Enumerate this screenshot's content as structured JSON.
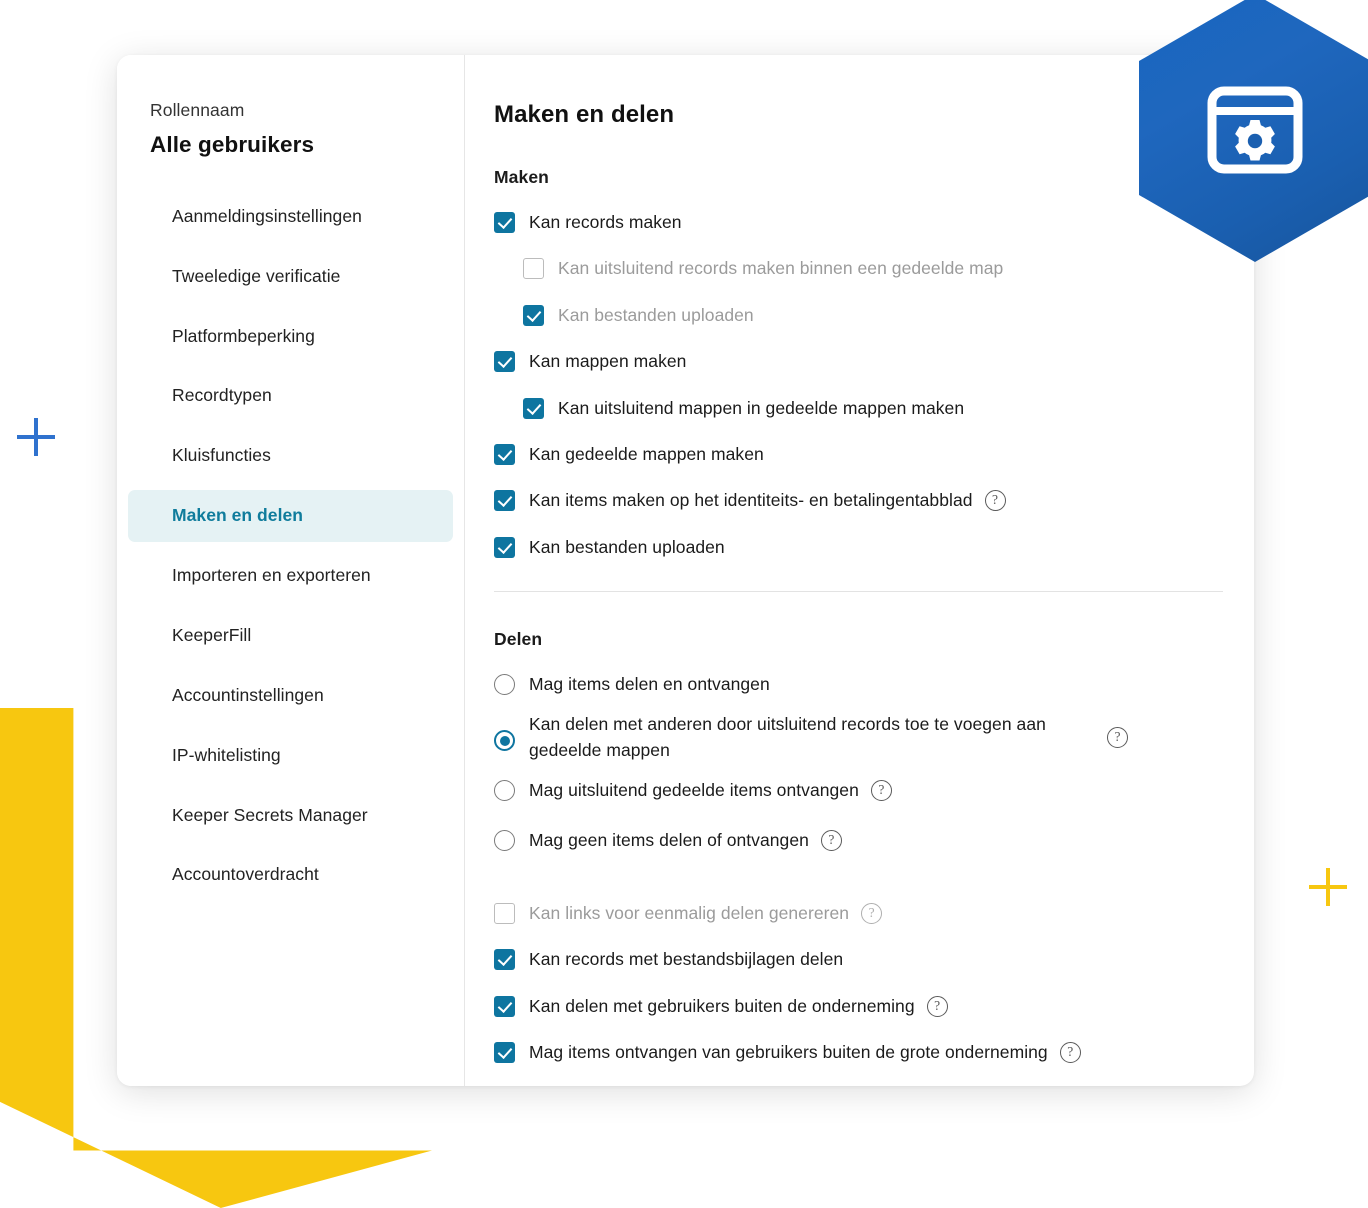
{
  "decor": {
    "hexagon_gradient_from": "#1766C0",
    "hexagon_gradient_to": "#17559D",
    "arrow_color": "#F7C710",
    "plus_blue_color": "#2F72CE",
    "plus_yellow_color": "#F7C710",
    "hex_icon_name": "browser-settings-gear-icon"
  },
  "sidebar": {
    "role_label": "Rollennaam",
    "role_name": "Alle gebruikers",
    "items": [
      {
        "label": "Aanmeldingsinstellingen",
        "active": false
      },
      {
        "label": "Tweeledige verificatie",
        "active": false
      },
      {
        "label": "Platformbeperking",
        "active": false
      },
      {
        "label": "Recordtypen",
        "active": false
      },
      {
        "label": "Kluisfuncties",
        "active": false
      },
      {
        "label": "Maken en delen",
        "active": true
      },
      {
        "label": "Importeren en exporteren",
        "active": false
      },
      {
        "label": "KeeperFill",
        "active": false
      },
      {
        "label": "Accountinstellingen",
        "active": false
      },
      {
        "label": "IP-whitelisting",
        "active": false
      },
      {
        "label": "Keeper Secrets Manager",
        "active": false
      },
      {
        "label": "Accountoverdracht",
        "active": false
      }
    ],
    "active_bg": "#E5F2F4",
    "active_text": "#0F7C9C"
  },
  "content": {
    "title": "Maken en delen",
    "maken": {
      "label": "Maken",
      "options": [
        {
          "label": "Kan records maken",
          "checked": true,
          "disabled": false,
          "indent": false,
          "help": false
        },
        {
          "label": "Kan uitsluitend records maken binnen een gedeelde map",
          "checked": false,
          "disabled": true,
          "indent": true,
          "help": false
        },
        {
          "label": "Kan bestanden uploaden",
          "checked": true,
          "disabled": true,
          "indent": true,
          "help": false
        },
        {
          "label": "Kan mappen maken",
          "checked": true,
          "disabled": false,
          "indent": false,
          "help": false
        },
        {
          "label": "Kan uitsluitend mappen in gedeelde mappen maken",
          "checked": true,
          "disabled": false,
          "indent": true,
          "help": false
        },
        {
          "label": "Kan gedeelde mappen maken",
          "checked": true,
          "disabled": false,
          "indent": false,
          "help": false
        },
        {
          "label": "Kan items maken op het identiteits- en betalingentabblad",
          "checked": true,
          "disabled": false,
          "indent": false,
          "help": true
        },
        {
          "label": "Kan bestanden uploaden",
          "checked": true,
          "disabled": false,
          "indent": false,
          "help": false
        }
      ]
    },
    "delen": {
      "label": "Delen",
      "radios": [
        {
          "label": "Mag items delen en ontvangen",
          "selected": false,
          "help": false
        },
        {
          "label": "Kan delen met anderen door uitsluitend records toe te voegen aan gedeelde mappen",
          "selected": true,
          "help": true
        },
        {
          "label": "Mag uitsluitend gedeelde items ontvangen",
          "selected": false,
          "help": true
        },
        {
          "label": "Mag geen items delen of ontvangen",
          "selected": false,
          "help": true
        }
      ],
      "options": [
        {
          "label": "Kan links voor eenmalig delen genereren",
          "checked": false,
          "disabled": true,
          "help": true
        },
        {
          "label": "Kan records met bestandsbijlagen delen",
          "checked": true,
          "disabled": false,
          "help": false
        },
        {
          "label": "Kan delen met gebruikers buiten de onderneming",
          "checked": true,
          "disabled": false,
          "help": true
        },
        {
          "label": "Mag items ontvangen van gebruikers buiten de grote onderneming",
          "checked": true,
          "disabled": false,
          "help": true
        }
      ]
    },
    "help_glyph": "?",
    "accent_checkbox": "#0E75A0"
  }
}
